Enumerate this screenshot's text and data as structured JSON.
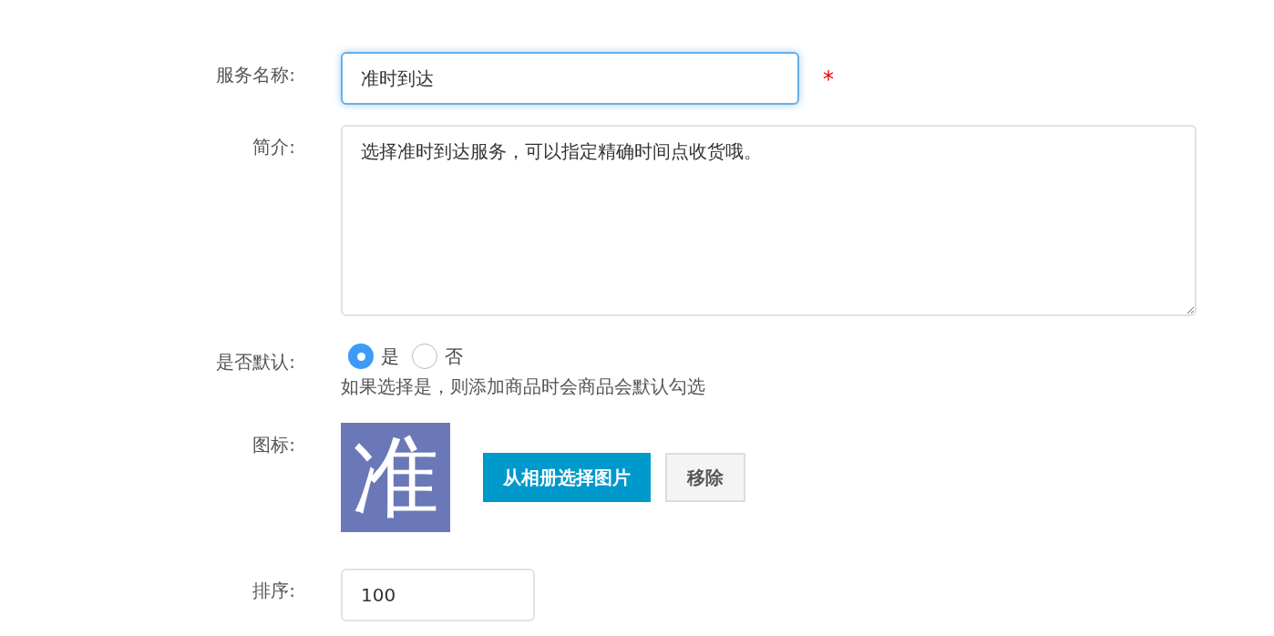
{
  "fields": [
    {
      "kind": "text",
      "label": "服务名称:",
      "value": "准时到达",
      "focused": true,
      "required": true,
      "required_mark": "*"
    },
    {
      "kind": "textarea",
      "label": "简介:",
      "value": "选择准时到达服务，可以指定精确时间点收货哦。"
    },
    {
      "kind": "radio",
      "label": "是否默认:",
      "options": [
        {
          "label": "是",
          "selected": true
        },
        {
          "label": "否",
          "selected": false
        }
      ],
      "hint": "如果选择是，则添加商品时会商品会默认勾选"
    },
    {
      "kind": "image",
      "label": "图标:",
      "image_text": "准",
      "buttons": [
        {
          "label": "从相册选择图片",
          "primary": true
        },
        {
          "label": "移除",
          "primary": false
        }
      ]
    },
    {
      "kind": "short-text",
      "label": "排序:",
      "value": "100"
    }
  ]
}
